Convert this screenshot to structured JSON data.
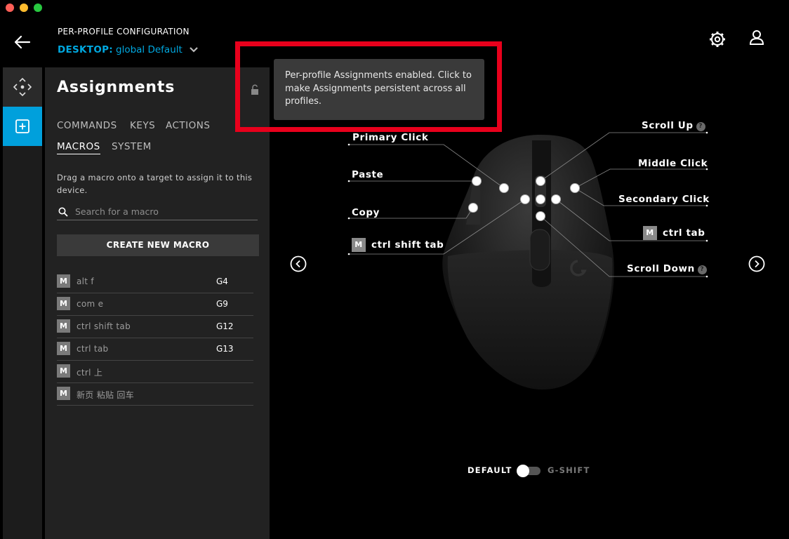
{
  "header": {
    "profile_label": "PER-PROFILE CONFIGURATION",
    "profile_kind": "DESKTOP:",
    "profile_name": "global Default"
  },
  "panel": {
    "title": "Assignments",
    "tabs": {
      "commands": "COMMANDS",
      "keys": "KEYS",
      "actions": "ACTIONS",
      "macros": "MACROS",
      "system": "SYSTEM"
    },
    "active_tab": "MACROS",
    "help_text": "Drag a macro onto a target to assign it to this device.",
    "search_placeholder": "Search for a macro",
    "create_button": "CREATE NEW MACRO",
    "badge_letter": "M",
    "macros": [
      {
        "name": "alt f",
        "key": "G4"
      },
      {
        "name": "com e",
        "key": "G9"
      },
      {
        "name": "ctrl shift tab",
        "key": "G12"
      },
      {
        "name": "ctrl tab",
        "key": "G13"
      },
      {
        "name": "ctrl 上",
        "key": ""
      },
      {
        "name": "新页 粘贴 回车",
        "key": ""
      }
    ]
  },
  "tooltip": {
    "text": "Per-profile Assignments enabled. Click to make Assignments persistent across all profiles."
  },
  "mouse_map": {
    "primary_click": "Primary Click",
    "paste": "Paste",
    "copy": "Copy",
    "ctrl_shift_tab": "ctrl shift tab",
    "scroll_up": "Scroll Up",
    "middle_click": "Middle Click",
    "secondary_click": "Secondary Click",
    "ctrl_tab": "ctrl tab",
    "scroll_down": "Scroll Down",
    "help_glyph": "?",
    "macro_glyph": "M"
  },
  "mode": {
    "default_label": "DEFAULT",
    "gshift_label": "G-SHIFT",
    "gshift_enabled": false
  },
  "colors": {
    "accent": "#00a0dc",
    "highlight": "#e8001c"
  }
}
